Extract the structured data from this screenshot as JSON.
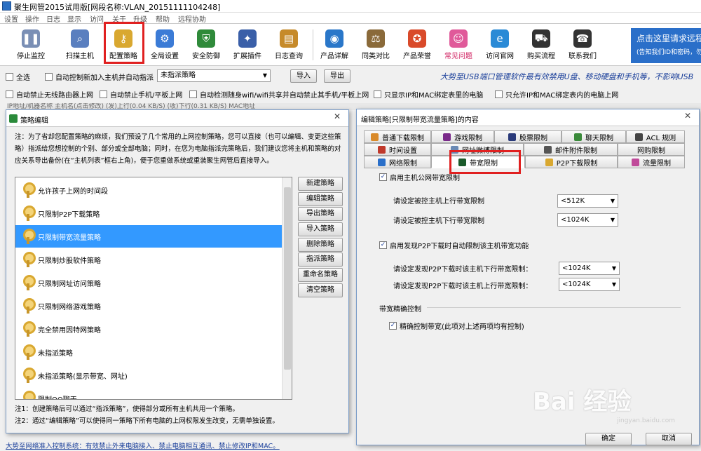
{
  "window": {
    "title": "聚生网管2015试用版[网段名称:VLAN_20151111104248]"
  },
  "menu": [
    "设置",
    "操作",
    "日志",
    "显示",
    "访问",
    "关于",
    "升级",
    "帮助",
    "远程协助"
  ],
  "toolbar": [
    {
      "label": "停止监控",
      "icon": "pause-icon",
      "color": "#7a8fb5"
    },
    {
      "label": "扫描主机",
      "icon": "magnifier-icon",
      "color": "#5a7fbf"
    },
    {
      "label": "配置策略",
      "icon": "key-icon",
      "color": "#d9a830"
    },
    {
      "label": "全局设置",
      "icon": "gear-icon",
      "color": "#3b7bd6"
    },
    {
      "label": "安全防御",
      "icon": "shield-icon",
      "color": "#2f8a3a"
    },
    {
      "label": "扩展插件",
      "icon": "plugin-icon",
      "color": "#3a5fa8"
    },
    {
      "label": "日志查询",
      "icon": "log-icon",
      "color": "#c68a2a"
    },
    {
      "label": "产品详解",
      "icon": "globe-icon",
      "color": "#2a77c9"
    },
    {
      "label": "同类对比",
      "icon": "compare-icon",
      "color": "#8a6a3a"
    },
    {
      "label": "产品荣誉",
      "icon": "medal-icon",
      "color": "#d94a2a"
    },
    {
      "label": "常见问题",
      "icon": "people-icon",
      "color": "#e05a9a"
    },
    {
      "label": "访问官网",
      "icon": "ie-icon",
      "color": "#2a8ad6"
    },
    {
      "label": "购买流程",
      "icon": "cart-icon",
      "color": "#333333"
    },
    {
      "label": "联系我们",
      "icon": "phone-icon",
      "color": "#333333"
    }
  ],
  "promo": {
    "line1": "点击这里请求远程",
    "line2": "(告知我们ID和密码，勿"
  },
  "row1": {
    "select_all": "全选",
    "auto_add": "自动控制新加入主机并自动指派",
    "policy_value": "未指派策略",
    "import": "导入",
    "export": "导出",
    "slogan": "大势至USB端口管理软件最有效禁用U盘、移动硬盘和手机等，不影响USB"
  },
  "row2": [
    "自动禁止无线路由器上网",
    "自动禁止手机/平板上网",
    "自动检测随身wifi/wifi共享并自动禁止其手机/平板上网",
    "只显示IP和MAC绑定表里的电脑",
    "只允许IP和MAC绑定表内的电脑上网"
  ],
  "header_strip": "IP地址/机器名称    主机名(点击修改)    (发)上行(0.04 KB/S)    (收)下行(0.31 KB/S)    MAC地址",
  "policy_editor": {
    "title": "策略编辑",
    "note": "注：为了省却您配置策略的麻烦，我们预设了几个常用的上网控制策略，您可以直接（也可以编辑、变更这些策略）指派给您想控制的个别、部分或全部电脑；同时，在您为电脑指派完策略后，我们建议您将主机和策略的对应关系导出备份(在“主机列表”框右上角)，便于您重做系统或重装聚生网管后直接导入。",
    "items": [
      "允许孩子上网的时间段",
      "只限制P2P下载策略",
      "只限制带宽流量策略",
      "只限制炒股软件策略",
      "只限制网址访问策略",
      "只限制网络游戏策略",
      "完全禁用因特网策略",
      "未指派策略",
      "未指派策略(显示带宽、网址)",
      "限制QQ聊天"
    ],
    "selected": 2,
    "buttons": [
      "新建策略",
      "编辑策略",
      "导出策略",
      "导入策略",
      "删除策略",
      "指派策略",
      "重命名策略",
      "清空策略"
    ],
    "note1": "注1：创建策略后可以通过“指派策略”，使得部分或所有主机共用一个策略。",
    "note2": "注2：通过“编辑策略”可以使得同一策略下所有电脑的上网权限发生改变，无需单独设置。"
  },
  "edit_dialog": {
    "title": "编辑策略[只限制带宽流量策略]的内容",
    "tabs_row1": [
      "普通下载限制",
      "游戏限制",
      "股票限制",
      "聊天限制",
      "ACL 规则"
    ],
    "tabs_row2": [
      "时间设置",
      "网址微博限制",
      "邮件附件限制",
      "网购限制"
    ],
    "tabs_row3": [
      "网络限制",
      "带宽限制",
      "P2P下载限制",
      "流量限制"
    ],
    "active_tab": "带宽限制",
    "enable_public": "启用主机公网带宽限制",
    "up_label": "请设定被控主机上行带宽限制",
    "up_value": "<512K",
    "down_label": "请设定被控主机下行带宽限制",
    "down_value": "<1024K",
    "enable_p2p": "启用发现P2P下载时自动限制该主机带宽功能",
    "p2p_down_label": "请设定发现P2P下载时该主机下行带宽限制：",
    "p2p_down_value": "<1024K",
    "p2p_up_label": "请设定发现P2P下载时该主机上行带宽限制：",
    "p2p_up_value": "<1024K",
    "precise_group": "带宽精确控制",
    "precise_label": "精确控制带宽(此项对上述两项均有控制)",
    "ok": "确定",
    "cancel": "取消"
  },
  "bottom": {
    "line": "大势至网络准入控制系统：有效禁止外来电脑接入、禁止电脑相互通讯、禁止修改IP和MAC。"
  },
  "watermark": {
    "main": "Bai 经验",
    "sub": "jingyan.baidu.com"
  }
}
